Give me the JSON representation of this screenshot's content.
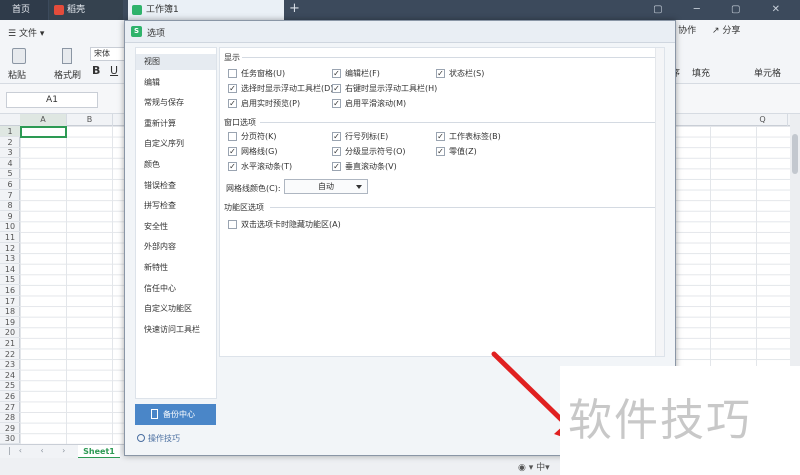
{
  "tabs": {
    "home": "首页",
    "draft": "稻壳",
    "workbook": "工作簿1"
  },
  "ribbon": {
    "file_menu": "文件",
    "paste": "粘贴",
    "format_painter": "格式刷",
    "font_name": "宋体",
    "collab": "协作",
    "share": "分享",
    "sort": "排序",
    "fill": "填充",
    "cell_format": "单元格"
  },
  "formula": {
    "namebox": "A1"
  },
  "grid": {
    "columns": [
      "A",
      "B",
      "Q"
    ],
    "rows": [
      "1",
      "2",
      "3",
      "4",
      "5",
      "6",
      "7",
      "8",
      "9",
      "10",
      "11",
      "12",
      "13",
      "14",
      "15",
      "16",
      "17",
      "18",
      "19",
      "20",
      "21",
      "22",
      "23",
      "24",
      "25",
      "26",
      "27",
      "28",
      "29",
      "30"
    ]
  },
  "sheet": {
    "name": "Sheet1"
  },
  "dialog": {
    "title": "选项",
    "nav": [
      "视图",
      "编辑",
      "常规与保存",
      "重新计算",
      "自定义序列",
      "颜色",
      "错误检查",
      "拼写检查",
      "安全性",
      "外部内容",
      "新特性",
      "信任中心",
      "自定义功能区",
      "快速访问工具栏"
    ],
    "active_nav": "视图",
    "backup_button": "备份中心",
    "tips_link": "操作技巧",
    "display": {
      "title": "显示",
      "options": [
        {
          "label": "任务窗格(U)",
          "checked": false
        },
        {
          "label": "编辑栏(F)",
          "checked": true
        },
        {
          "label": "状态栏(S)",
          "checked": true
        },
        {
          "label": "选择时显示浮动工具栏(D)",
          "checked": true
        },
        {
          "label": "右键时显示浮动工具栏(H)",
          "checked": true
        },
        {
          "label": "启用实时预览(P)",
          "checked": true
        },
        {
          "label": "启用平滑滚动(M)",
          "checked": true
        }
      ]
    },
    "window": {
      "title": "窗口选项",
      "options": [
        {
          "label": "分页符(K)",
          "checked": false
        },
        {
          "label": "行号列标(E)",
          "checked": true
        },
        {
          "label": "工作表标签(B)",
          "checked": true
        },
        {
          "label": "网格线(G)",
          "checked": true
        },
        {
          "label": "分级显示符号(O)",
          "checked": true
        },
        {
          "label": "零值(Z)",
          "checked": true
        },
        {
          "label": "水平滚动条(T)",
          "checked": true
        },
        {
          "label": "垂直滚动条(V)",
          "checked": true
        }
      ],
      "gridline_color_label": "网格线颜色(C):",
      "gridline_color_value": "自动"
    },
    "ribbon_section": {
      "title": "功能区选项",
      "options": [
        {
          "label": "双击选项卡时隐藏功能区(A)",
          "checked": false
        }
      ]
    }
  },
  "watermark": "软件技巧",
  "colors": {
    "accent_green": "#2d9a54",
    "backup_blue": "#4a86c8",
    "arrow_red": "#e02020"
  }
}
